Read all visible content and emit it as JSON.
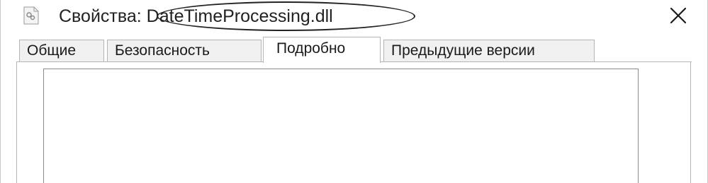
{
  "window": {
    "title_prefix": "Свойства: ",
    "title_filename": "DateTimeProcessing.dll",
    "title_icon": "dll-file-icon",
    "close_icon": "close-icon"
  },
  "tabs": [
    {
      "label": "Общие",
      "active": false
    },
    {
      "label": "Безопасность",
      "active": false
    },
    {
      "label": "Подробно",
      "active": true
    },
    {
      "label": "Предыдущие версии",
      "active": false
    }
  ]
}
